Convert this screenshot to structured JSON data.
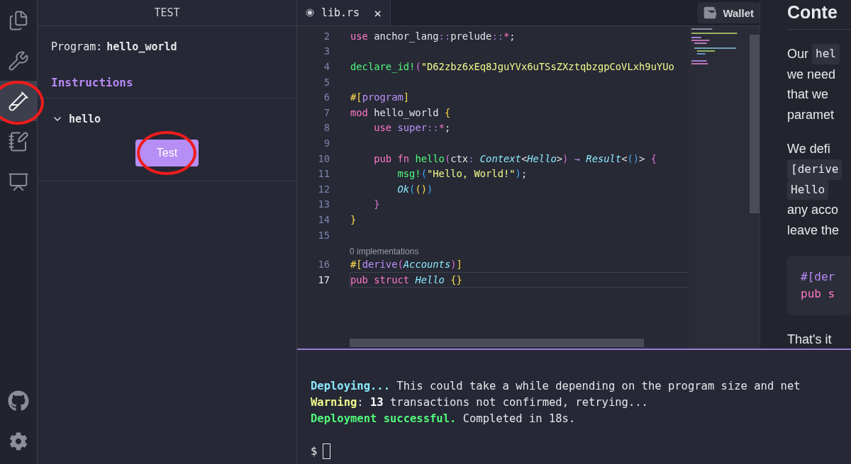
{
  "sidebar": {
    "items": [
      {
        "selected": false,
        "highlighted": false
      },
      {
        "selected": false,
        "highlighted": false
      },
      {
        "selected": true,
        "highlighted": true
      },
      {
        "selected": false,
        "highlighted": false
      },
      {
        "selected": false,
        "highlighted": false
      }
    ]
  },
  "test_panel": {
    "title": "TEST",
    "program_label": "Program:",
    "program_name": "hello_world",
    "instructions_heading": "Instructions",
    "instructions": [
      {
        "name": "hello",
        "expanded": true,
        "button": "Test",
        "highlighted": true
      }
    ]
  },
  "editor": {
    "tabs": [
      {
        "label": "lib.rs",
        "close": "×",
        "selected": true
      }
    ],
    "wallet_button": "Wallet",
    "lines": [
      {
        "number": "2",
        "current": false,
        "tokens": [
          {
            "text": "use",
            "kind": "kw"
          },
          {
            "text": " anchor_lang",
            "kind": "id"
          },
          {
            "text": "::",
            "kind": "punct"
          },
          {
            "text": "prelude",
            "kind": "id"
          },
          {
            "text": "::",
            "kind": "punct"
          },
          {
            "text": "*",
            "kind": "kw"
          },
          {
            "text": ";",
            "kind": "id"
          }
        ]
      },
      {
        "number": "3",
        "current": false
      },
      {
        "number": "4",
        "current": false,
        "tokens": [
          {
            "text": "declare_id!",
            "kind": "fn"
          },
          {
            "text": "(",
            "kind": "b2"
          },
          {
            "text": "\"D62zbz6xEq8JguYVx6uTSsZXztqbzgpCoVLxh9uYUo",
            "kind": "str"
          }
        ]
      },
      {
        "number": "5",
        "current": false
      },
      {
        "number": "6",
        "current": false,
        "tokens": [
          {
            "text": "#[",
            "kind": "b1"
          },
          {
            "text": "program",
            "kind": "attr"
          },
          {
            "text": "]",
            "kind": "b1"
          }
        ]
      },
      {
        "number": "7",
        "current": false,
        "tokens": [
          {
            "text": "mod",
            "kind": "kw"
          },
          {
            "text": " hello_world ",
            "kind": "id"
          },
          {
            "text": "{",
            "kind": "b1"
          }
        ]
      },
      {
        "number": "8",
        "current": false,
        "tokens": [
          {
            "text": "    use",
            "kind": "kw"
          },
          {
            "text": " super",
            "kind": "attr"
          },
          {
            "text": "::",
            "kind": "punct"
          },
          {
            "text": "*",
            "kind": "kw"
          },
          {
            "text": ";",
            "kind": "id"
          }
        ]
      },
      {
        "number": "9",
        "current": false
      },
      {
        "number": "10",
        "current": false,
        "tokens": [
          {
            "text": "    pub",
            "kind": "kw"
          },
          {
            "text": " fn",
            "kind": "kw"
          },
          {
            "text": " hello",
            "kind": "fn"
          },
          {
            "text": "(",
            "kind": "b2"
          },
          {
            "text": "ctx",
            "kind": "id"
          },
          {
            "text": ":",
            "kind": "punct"
          },
          {
            "text": " Context",
            "kind": "type"
          },
          {
            "text": "<",
            "kind": "id"
          },
          {
            "text": "Hello",
            "kind": "type"
          },
          {
            "text": ">",
            "kind": "id"
          },
          {
            "text": ")",
            "kind": "b2"
          },
          {
            "text": " → ",
            "kind": "punct"
          },
          {
            "text": "Result",
            "kind": "type"
          },
          {
            "text": "<",
            "kind": "id"
          },
          {
            "text": "()",
            "kind": "b3"
          },
          {
            "text": "> ",
            "kind": "id"
          },
          {
            "text": "{",
            "kind": "b2"
          }
        ]
      },
      {
        "number": "11",
        "current": false,
        "tokens": [
          {
            "text": "        msg!",
            "kind": "fn"
          },
          {
            "text": "(",
            "kind": "b3"
          },
          {
            "text": "\"Hello, World!\"",
            "kind": "str"
          },
          {
            "text": ")",
            "kind": "b3"
          },
          {
            "text": ";",
            "kind": "id"
          }
        ]
      },
      {
        "number": "12",
        "current": false,
        "tokens": [
          {
            "text": "        Ok",
            "kind": "type"
          },
          {
            "text": "(",
            "kind": "b3"
          },
          {
            "text": "()",
            "kind": "b1"
          },
          {
            "text": ")",
            "kind": "b3"
          }
        ]
      },
      {
        "number": "13",
        "current": false,
        "tokens": [
          {
            "text": "    }",
            "kind": "b2"
          }
        ]
      },
      {
        "number": "14",
        "current": false,
        "tokens": [
          {
            "text": "}",
            "kind": "b1"
          }
        ]
      },
      {
        "number": "15",
        "current": false,
        "lens": "0 implementations"
      },
      {
        "number": "16",
        "current": false,
        "tokens": [
          {
            "text": "#[",
            "kind": "b1"
          },
          {
            "text": "derive",
            "kind": "attr"
          },
          {
            "text": "(",
            "kind": "b2"
          },
          {
            "text": "Accounts",
            "kind": "type"
          },
          {
            "text": ")",
            "kind": "b2"
          },
          {
            "text": "]",
            "kind": "b1"
          }
        ]
      },
      {
        "number": "17",
        "current": true,
        "tokens": [
          {
            "text": "pub",
            "kind": "kw"
          },
          {
            "text": " struct",
            "kind": "kw"
          },
          {
            "text": " Hello ",
            "kind": "type"
          },
          {
            "text": "{}",
            "kind": "b1"
          }
        ]
      }
    ]
  },
  "docs": {
    "heading": "Conte",
    "blocks": [
      {
        "kind": "para",
        "lines": [
          [
            {
              "text": "Our",
              "code": false
            },
            {
              "text": "hel",
              "code": true
            }
          ],
          [
            {
              "text": "we need",
              "code": false
            }
          ],
          [
            {
              "text": "that we",
              "code": false
            }
          ],
          [
            {
              "text": "paramet",
              "code": false
            }
          ]
        ]
      },
      {
        "kind": "para",
        "lines": [
          [
            {
              "text": "We defi",
              "code": false
            }
          ],
          [
            {
              "text": "[derive",
              "code": true
            }
          ],
          [
            {
              "text": "Hello",
              "code": true
            }
          ],
          [
            {
              "text": "any acco",
              "code": false
            }
          ],
          [
            {
              "text": "leave the",
              "code": false
            }
          ]
        ]
      },
      {
        "kind": "code",
        "lines": [
          "#[der",
          "pub s"
        ]
      },
      {
        "kind": "para",
        "lines": [
          [
            {
              "text": "That's it",
              "code": false
            }
          ]
        ]
      }
    ]
  },
  "terminal": {
    "lines": [
      [
        {
          "text": "Deploying...",
          "kind": "info"
        },
        {
          "text": " This could take a while depending on the program size and net",
          "kind": "plain"
        }
      ],
      [
        {
          "text": "Warning",
          "kind": "warn"
        },
        {
          "text": ": ",
          "kind": "plain"
        },
        {
          "text": "13",
          "kind": "bold"
        },
        {
          "text": " transactions not confirmed, retrying...",
          "kind": "plain"
        }
      ],
      [
        {
          "text": "Deployment successful.",
          "kind": "success"
        },
        {
          "text": " Completed in 18s.",
          "kind": "plain"
        }
      ]
    ],
    "prompt": "$"
  }
}
